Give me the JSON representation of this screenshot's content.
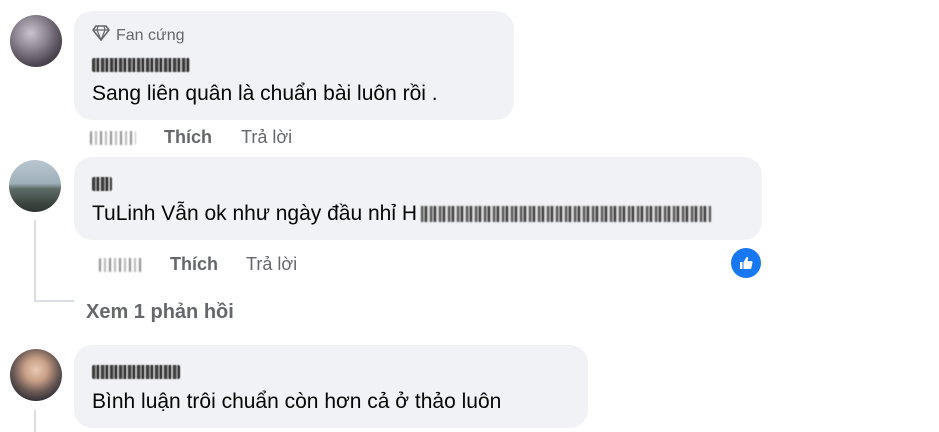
{
  "comments": [
    {
      "badge_label": "Fan cứng",
      "text": "Sang liên quân là chuẩn bài luôn rồi .",
      "like_label": "Thích",
      "reply_label": "Trả lời"
    },
    {
      "text": "TuLinh Vẫn ok như ngày đầu nhỉ H",
      "like_label": "Thích",
      "reply_label": "Trả lời",
      "reaction_icon": "thumbs-up-icon"
    },
    {
      "text": "Bình luận trôi chuẩn còn hơn cả ở thảo luôn"
    }
  ],
  "view_replies_label": "Xem 1 phản hồi",
  "colors": {
    "bubble": "#f0f2f5",
    "muted": "#65676b",
    "reaction_blue": "#1877f2"
  }
}
